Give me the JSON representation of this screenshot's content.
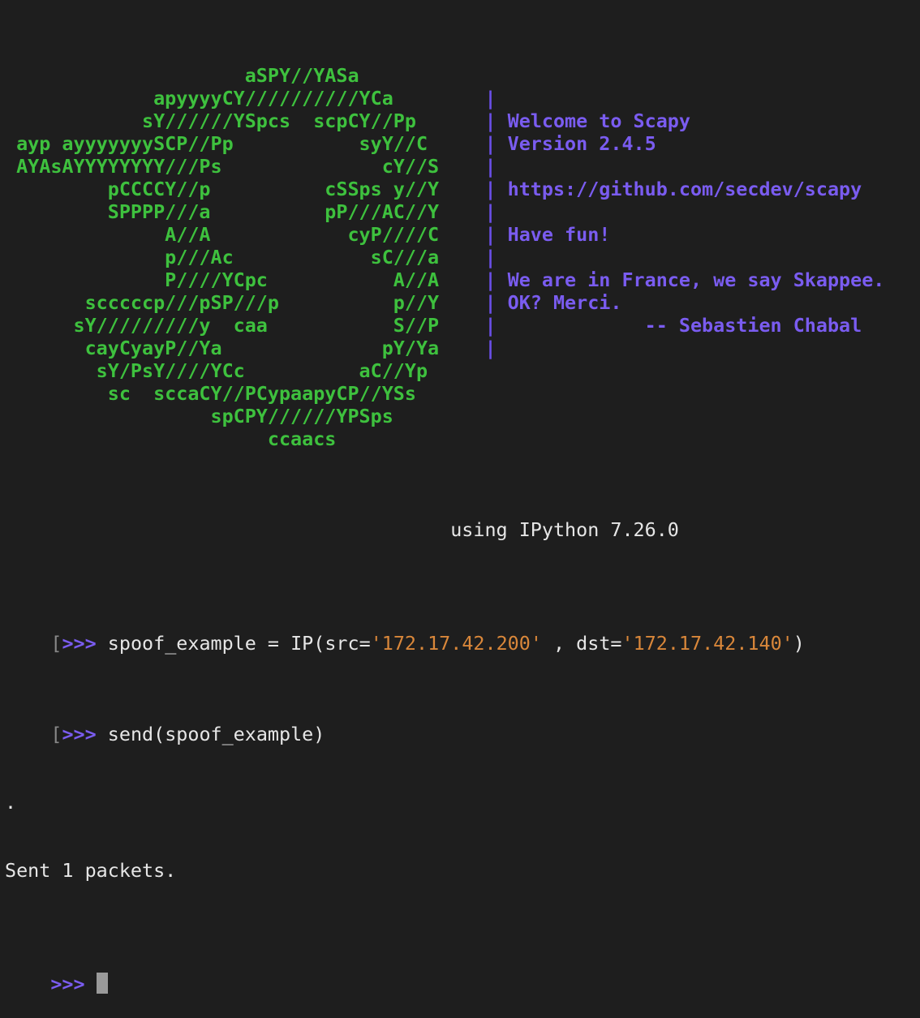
{
  "banner": {
    "rows": [
      {
        "art": "                     aSPY//YASa             ",
        "sep": "",
        "info": ""
      },
      {
        "art": "             apyyyyCY//////////YCa        ",
        "sep": "|",
        "info": ""
      },
      {
        "art": "            sY//////YSpcs  scpCY//Pp      ",
        "sep": "|",
        "info": " Welcome to Scapy"
      },
      {
        "art": " ayp ayyyyyyySCP//Pp           syY//C     ",
        "sep": "|",
        "info": " Version 2.4.5"
      },
      {
        "art": " AYAsAYYYYYYYY///Ps              cY//S    ",
        "sep": "|",
        "info": ""
      },
      {
        "art": "         pCCCCY//p          cSSps y//Y    ",
        "sep": "|",
        "info": " https://github.com/secdev/scapy"
      },
      {
        "art": "         SPPPP///a          pP///AC//Y    ",
        "sep": "|",
        "info": ""
      },
      {
        "art": "              A//A            cyP////C    ",
        "sep": "|",
        "info": " Have fun!"
      },
      {
        "art": "              p///Ac            sC///a    ",
        "sep": "|",
        "info": ""
      },
      {
        "art": "              P////YCpc           A//A    ",
        "sep": "|",
        "info": " We are in France, we say Skappee."
      },
      {
        "art": "       scccccp///pSP///p          p//Y    ",
        "sep": "|",
        "info": " OK? Merci."
      },
      {
        "art": "      sY/////////y  caa           S//P    ",
        "sep": "|",
        "info": "             -- Sebastien Chabal"
      },
      {
        "art": "       cayCyayP//Ya              pY/Ya    ",
        "sep": "|",
        "info": ""
      },
      {
        "art": "        sY/PsY////YCc          aC//Yp     ",
        "sep": "",
        "info": ""
      },
      {
        "art": "         sc  sccaCY//PCypaapyCP//YSs      ",
        "sep": "",
        "info": ""
      },
      {
        "art": "                  spCPY//////YPSps        ",
        "sep": "",
        "info": ""
      },
      {
        "art": "                       ccaacs             ",
        "sep": "",
        "info": ""
      }
    ],
    "ipython_line": "                                       using IPython 7.26.0"
  },
  "session": {
    "bracket": "[",
    "prompt": ">>> ",
    "cmd1_pre": "spoof_example = IP(src=",
    "cmd1_src": "'172.17.42.200'",
    "cmd1_mid": " , dst=",
    "cmd1_dst": "'172.17.42.140'",
    "cmd1_post": ")",
    "cmd2": "send(spoof_example)",
    "dot": ".",
    "sent": "Sent 1 packets."
  }
}
